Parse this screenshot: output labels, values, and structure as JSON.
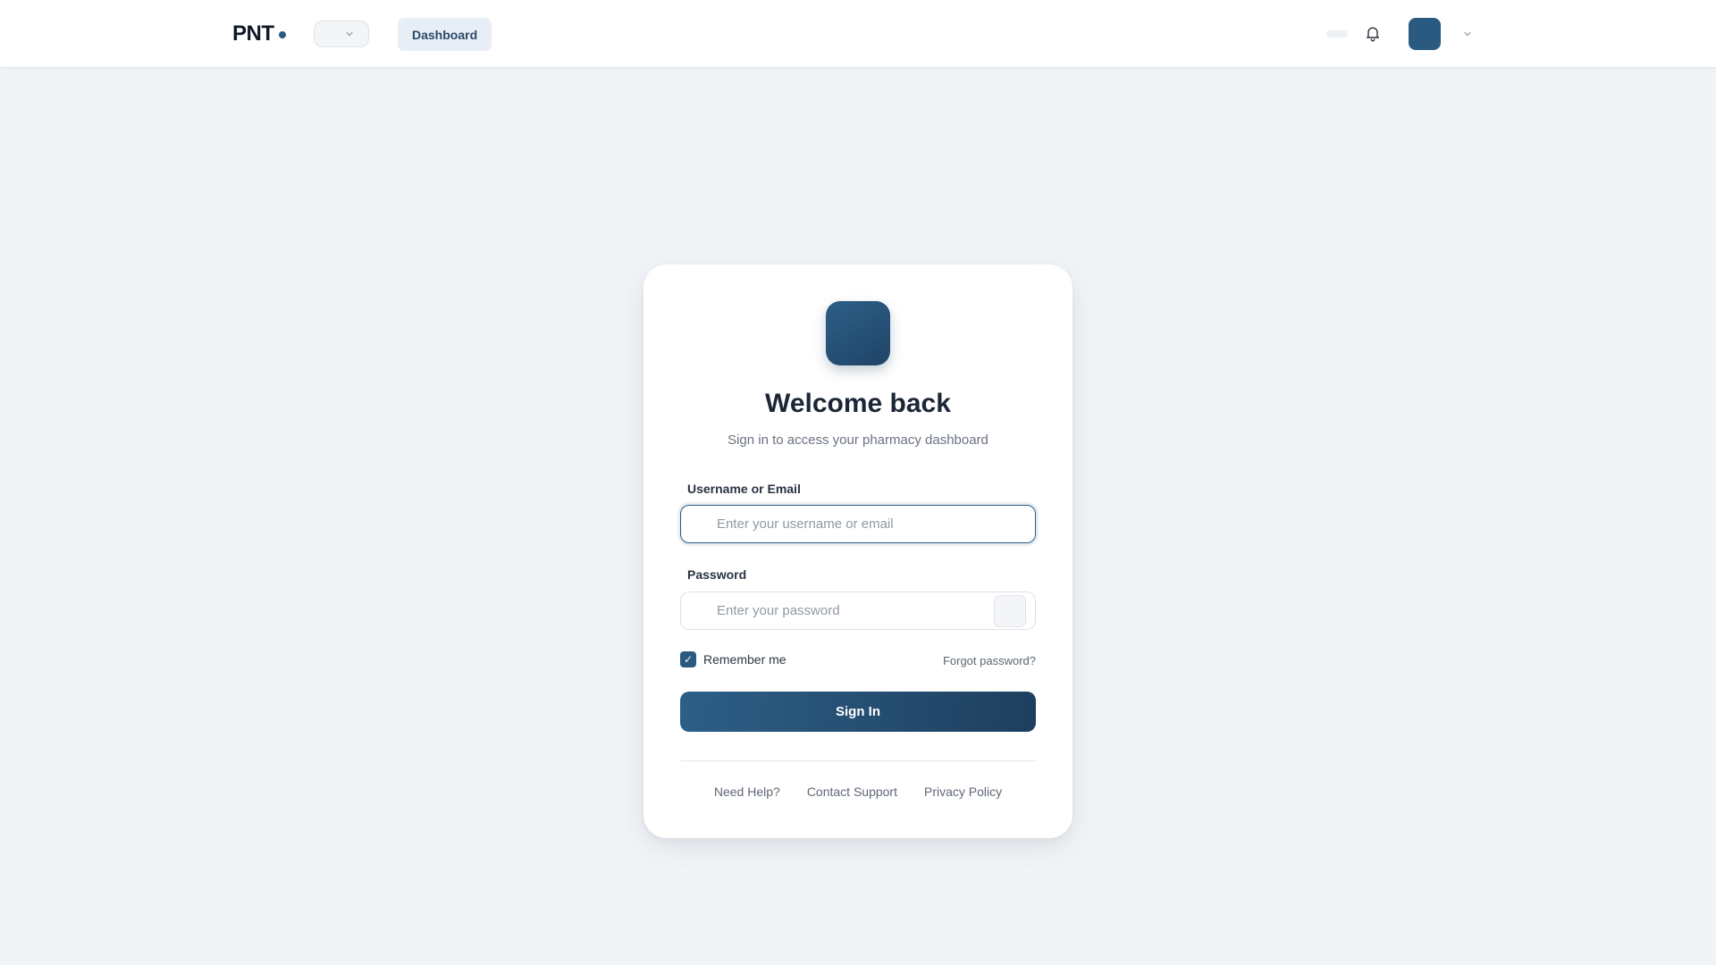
{
  "header": {
    "brand": "PNT",
    "nav_dashboard": "Dashboard",
    "icons": [
      "chevron-down-icon",
      "bell-icon"
    ]
  },
  "login": {
    "title": "Welcome back",
    "subtitle": "Sign in to access your pharmacy dashboard",
    "username_label": "Username or Email",
    "username_placeholder": "Enter your username or email",
    "username_value": "",
    "password_label": "Password",
    "password_placeholder": "Enter your password",
    "password_value": "",
    "remember_label": "Remember me",
    "remember_checked": true,
    "remember_check_glyph": "✓",
    "forgot_label": "Forgot password?",
    "signin_label": "Sign In"
  },
  "footer": {
    "links": [
      "Need Help?",
      "Contact Support",
      "Privacy Policy"
    ]
  },
  "colors": {
    "brand_primary": "#2b5a80",
    "brand_dark": "#1e3f5e",
    "page_background": "#f1f4f7"
  }
}
